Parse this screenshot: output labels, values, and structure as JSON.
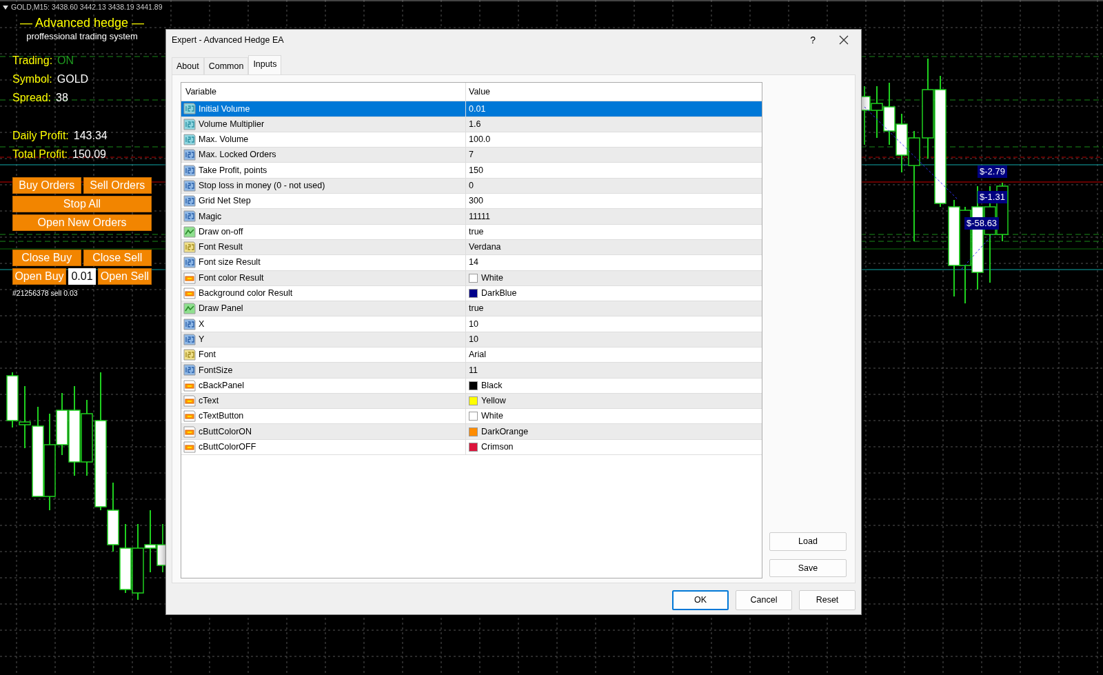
{
  "chart": {
    "header": "GOLD,M15: 3438.60 3442.13 3438.19 3441.89",
    "price_labels": [
      "$-2.79",
      "$-1.31",
      "$-58.63"
    ]
  },
  "panel": {
    "title": "— Advanced hedge —",
    "subtitle": "proffessional trading system",
    "stats": [
      {
        "label": "Trading:",
        "value": "ON",
        "color": "#1f9a1f"
      },
      {
        "label": "Symbol:",
        "value": "GOLD",
        "color": "#ffffff"
      },
      {
        "label": "Spread:",
        "value": "38",
        "color": "#ffffff"
      },
      {
        "label": "Daily Profit:",
        "value": "143.34",
        "color": "#ffffff"
      },
      {
        "label": "Total Profit:",
        "value": "150.09",
        "color": "#ffffff"
      }
    ],
    "order_rows": [
      [
        {
          "kind": "button",
          "label": "Buy Orders"
        },
        {
          "kind": "button",
          "label": "Sell Orders"
        }
      ],
      [
        {
          "kind": "button",
          "label": "Stop All"
        }
      ],
      [
        {
          "kind": "button",
          "label": "Open New Orders"
        }
      ]
    ],
    "trade_rows": [
      [
        {
          "kind": "button",
          "label": "Close Buy"
        },
        {
          "kind": "button",
          "label": "Close Sell"
        }
      ],
      [
        {
          "kind": "button",
          "label": "Open Buy"
        },
        {
          "kind": "field",
          "value": "0.01"
        },
        {
          "kind": "button",
          "label": "Open Sell"
        }
      ]
    ],
    "order_note": "#21256378 sell 0.03"
  },
  "dialog": {
    "title": "Expert - Advanced Hedge EA",
    "help": "?",
    "tabs": [
      {
        "label": "About",
        "selected": false
      },
      {
        "label": "Common",
        "selected": false
      },
      {
        "label": "Inputs",
        "selected": true
      }
    ],
    "columns": [
      "Variable",
      "Value"
    ],
    "rows": [
      {
        "kind": "double",
        "variable": "Initial Volume",
        "value": "0.01",
        "selected": true
      },
      {
        "kind": "double",
        "variable": "Volume Multiplier",
        "value": "1.6",
        "selected": false
      },
      {
        "kind": "double",
        "variable": "Max. Volume",
        "value": "100.0",
        "selected": false
      },
      {
        "kind": "int",
        "variable": "Max. Locked Orders",
        "value": "7",
        "selected": false
      },
      {
        "kind": "int",
        "variable": "Take Profit, points",
        "value": "150",
        "selected": false
      },
      {
        "kind": "int",
        "variable": "Stop loss in money (0 - not used)",
        "value": "0",
        "selected": false
      },
      {
        "kind": "int",
        "variable": "Grid Net Step",
        "value": "300",
        "selected": false
      },
      {
        "kind": "int",
        "variable": "Magic",
        "value": "11111",
        "selected": false
      },
      {
        "kind": "bool",
        "variable": "Draw on-off",
        "value": "true",
        "selected": false
      },
      {
        "kind": "string",
        "variable": "Font Result",
        "value": "Verdana",
        "selected": false
      },
      {
        "kind": "int",
        "variable": "Font size Result",
        "value": "14",
        "selected": false
      },
      {
        "kind": "color",
        "variable": "Font color Result",
        "value": "White",
        "color": "#ffffff",
        "selected": false
      },
      {
        "kind": "color",
        "variable": "Background color Result",
        "value": "DarkBlue",
        "color": "#00008b",
        "selected": false
      },
      {
        "kind": "bool",
        "variable": "Draw Panel",
        "value": "true",
        "selected": false
      },
      {
        "kind": "int",
        "variable": "X",
        "value": "10",
        "selected": false
      },
      {
        "kind": "int",
        "variable": "Y",
        "value": "10",
        "selected": false
      },
      {
        "kind": "string",
        "variable": "Font",
        "value": "Arial",
        "selected": false
      },
      {
        "kind": "int",
        "variable": "FontSize",
        "value": "11",
        "selected": false
      },
      {
        "kind": "color",
        "variable": "cBackPanel",
        "value": "Black",
        "color": "#000000",
        "selected": false
      },
      {
        "kind": "color",
        "variable": "cText",
        "value": "Yellow",
        "color": "#ffff00",
        "selected": false
      },
      {
        "kind": "color",
        "variable": "cTextButton",
        "value": "White",
        "color": "#ffffff",
        "selected": false
      },
      {
        "kind": "color",
        "variable": "cButtColorON",
        "value": "DarkOrange",
        "color": "#ff8c00",
        "selected": false
      },
      {
        "kind": "color",
        "variable": "cButtColorOFF",
        "value": "Crimson",
        "color": "#dc143c",
        "selected": false
      }
    ],
    "side_buttons": [
      "Load",
      "Save"
    ],
    "buttons": [
      {
        "label": "OK",
        "default": true
      },
      {
        "label": "Cancel",
        "default": false
      },
      {
        "label": "Reset",
        "default": false
      }
    ]
  }
}
